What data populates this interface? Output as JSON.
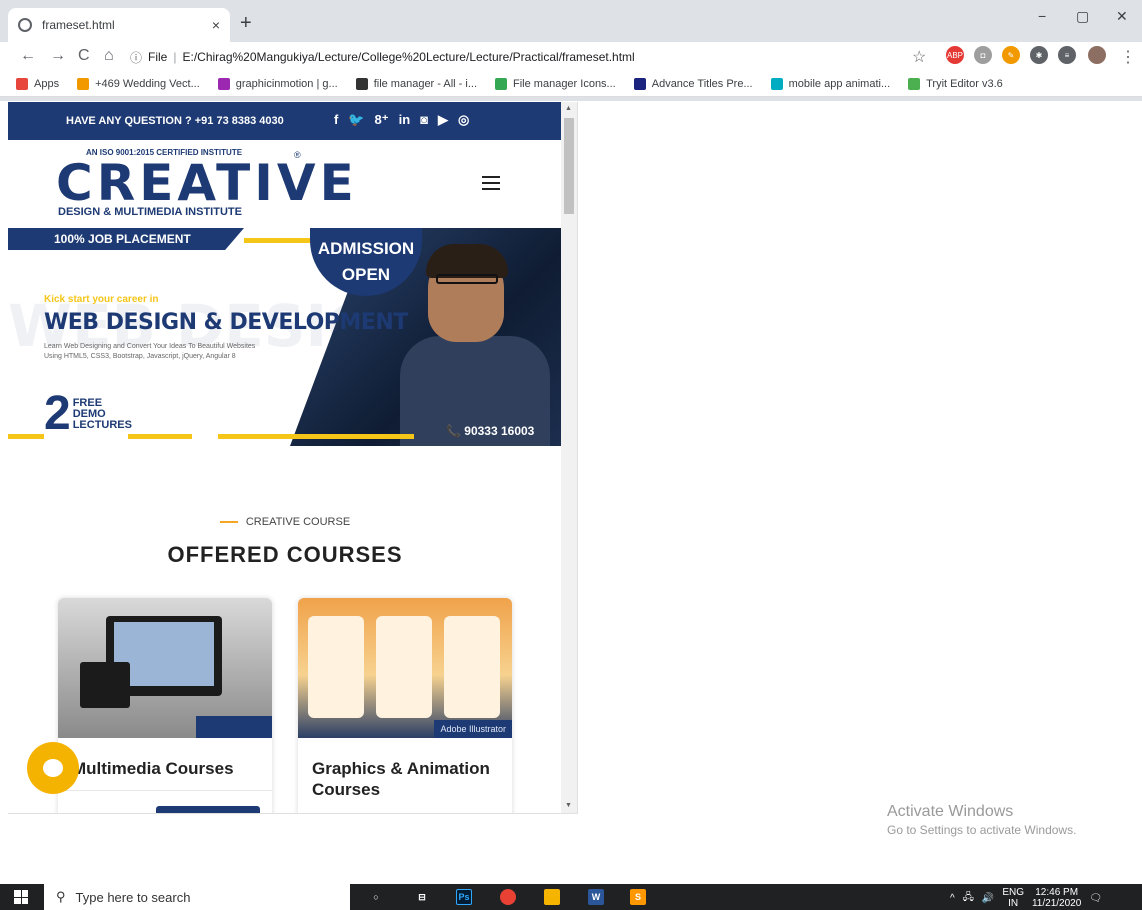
{
  "browser": {
    "tab_title": "frameset.html",
    "tab_close": "×",
    "new_tab": "+",
    "window_controls": [
      "−",
      "▢",
      "✕"
    ],
    "nav": {
      "back": "←",
      "forward": "→",
      "reload": "C",
      "home": "⌂"
    },
    "omnibox": {
      "info": "ⓘ",
      "scheme": "File",
      "url": "E:/Chirag%20Mangukiya/Lecture/College%20Lecture/Lecture/Practical/frameset.html"
    },
    "extensions": [
      "☆",
      "ABP",
      "◘",
      "✎",
      "✱",
      "≡"
    ],
    "bookmarks": [
      {
        "label": "Apps",
        "color": "#e8453c"
      },
      {
        "label": "+469 Wedding Vect...",
        "color": "#f29900"
      },
      {
        "label": "graphicinmotion | g...",
        "color": "#9c27b0"
      },
      {
        "label": "file manager - All - i...",
        "color": "#333333"
      },
      {
        "label": "File manager Icons...",
        "color": "#34a853"
      },
      {
        "label": "Advance Titles Pre...",
        "color": "#1a237e"
      },
      {
        "label": "mobile app animati...",
        "color": "#00acc1"
      },
      {
        "label": "Tryit Editor v3.6",
        "color": "#4caf50"
      }
    ]
  },
  "site": {
    "topbar_text": "HAVE ANY QUESTION ? +91 73 8383 4030",
    "social": [
      "f",
      "🐦",
      "8⁺",
      "in",
      "◙",
      "▶",
      "◎"
    ],
    "logo": {
      "certified": "AN ISO 9001:2015 CERTIFIED INSTITUTE",
      "main": "CREATIVE",
      "sub": "DESIGN & MULTIMEDIA INSTITUTE",
      "reg": "®"
    },
    "banner": {
      "job": "100% JOB PLACEMENT",
      "admission_line1": "ADMISSION",
      "admission_line2": "OPEN",
      "kick": "Kick start your career in",
      "title": "WEB DESIGN & DEVELOPMENT",
      "watermark": "WEB DESIGN &",
      "desc_line1": "Learn Web Designing and Convert Your Ideas To Beautiful Websites",
      "desc_line2": "Using HTML5, CSS3, Bootstrap, Javascript, jQuery, Angular 8",
      "demo_num": "2",
      "demo_l1": "FREE",
      "demo_l2": "DEMO",
      "demo_l3": "LECTURES",
      "phone": "📞 90333 16003"
    },
    "section_label": "CREATIVE COURSE",
    "section_title": "OFFERED COURSES",
    "cards": [
      {
        "title": "Multimedia Courses",
        "tag": ""
      },
      {
        "title": "Graphics & Animation Courses",
        "tag": "Adobe Illustrator"
      }
    ]
  },
  "activate": {
    "line1": "Activate Windows",
    "line2": "Go to Settings to activate Windows."
  },
  "taskbar": {
    "search_placeholder": "Type here to search",
    "tray_lang": "ENG",
    "tray_region": "IN",
    "time": "12:46 PM",
    "date": "11/21/2020"
  }
}
